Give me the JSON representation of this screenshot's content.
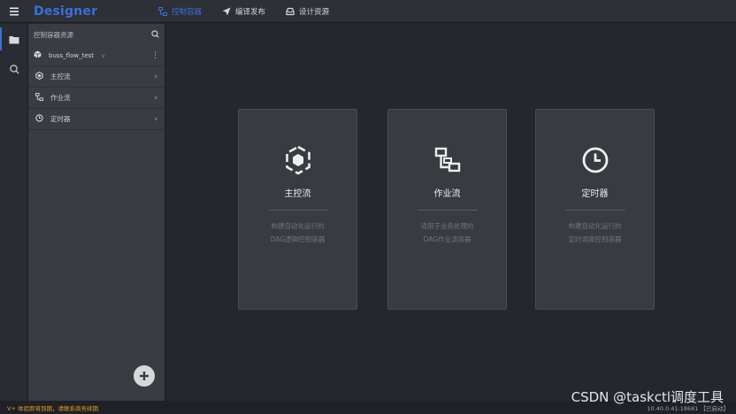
{
  "topbar": {
    "brand": "Designer",
    "tabs": [
      {
        "label": "控制容器",
        "icon": "flow-icon",
        "active": true
      },
      {
        "label": "编译发布",
        "icon": "send-icon",
        "active": false
      },
      {
        "label": "设计资源",
        "icon": "inbox-icon",
        "active": false
      }
    ]
  },
  "sidebar": {
    "title": "控制容器资源",
    "project": "buss_flow_test",
    "items": [
      {
        "label": "主控流",
        "icon": "hexagon-icon"
      },
      {
        "label": "作业流",
        "icon": "branch-icon"
      },
      {
        "label": "定时器",
        "icon": "clock-icon"
      }
    ]
  },
  "cards": [
    {
      "title": "主控流",
      "line1": "构建自动化运行的",
      "line2": "DAG逻辑控制容器"
    },
    {
      "title": "作业流",
      "line1": "适用于业务处理的",
      "line2": "DAG作业流容器"
    },
    {
      "title": "定时器",
      "line1": "构建自动化运行的",
      "line2": "定时调度控制容器"
    }
  ],
  "statusbar": {
    "warning": "V+ 体验即将到期，请联系商务续期",
    "right": "10.40.0.41:18681 【已启动】"
  },
  "watermark": "CSDN @taskctl调度工具",
  "colors": {
    "accent": "#3b6fd8",
    "warning": "#e39a2c"
  }
}
